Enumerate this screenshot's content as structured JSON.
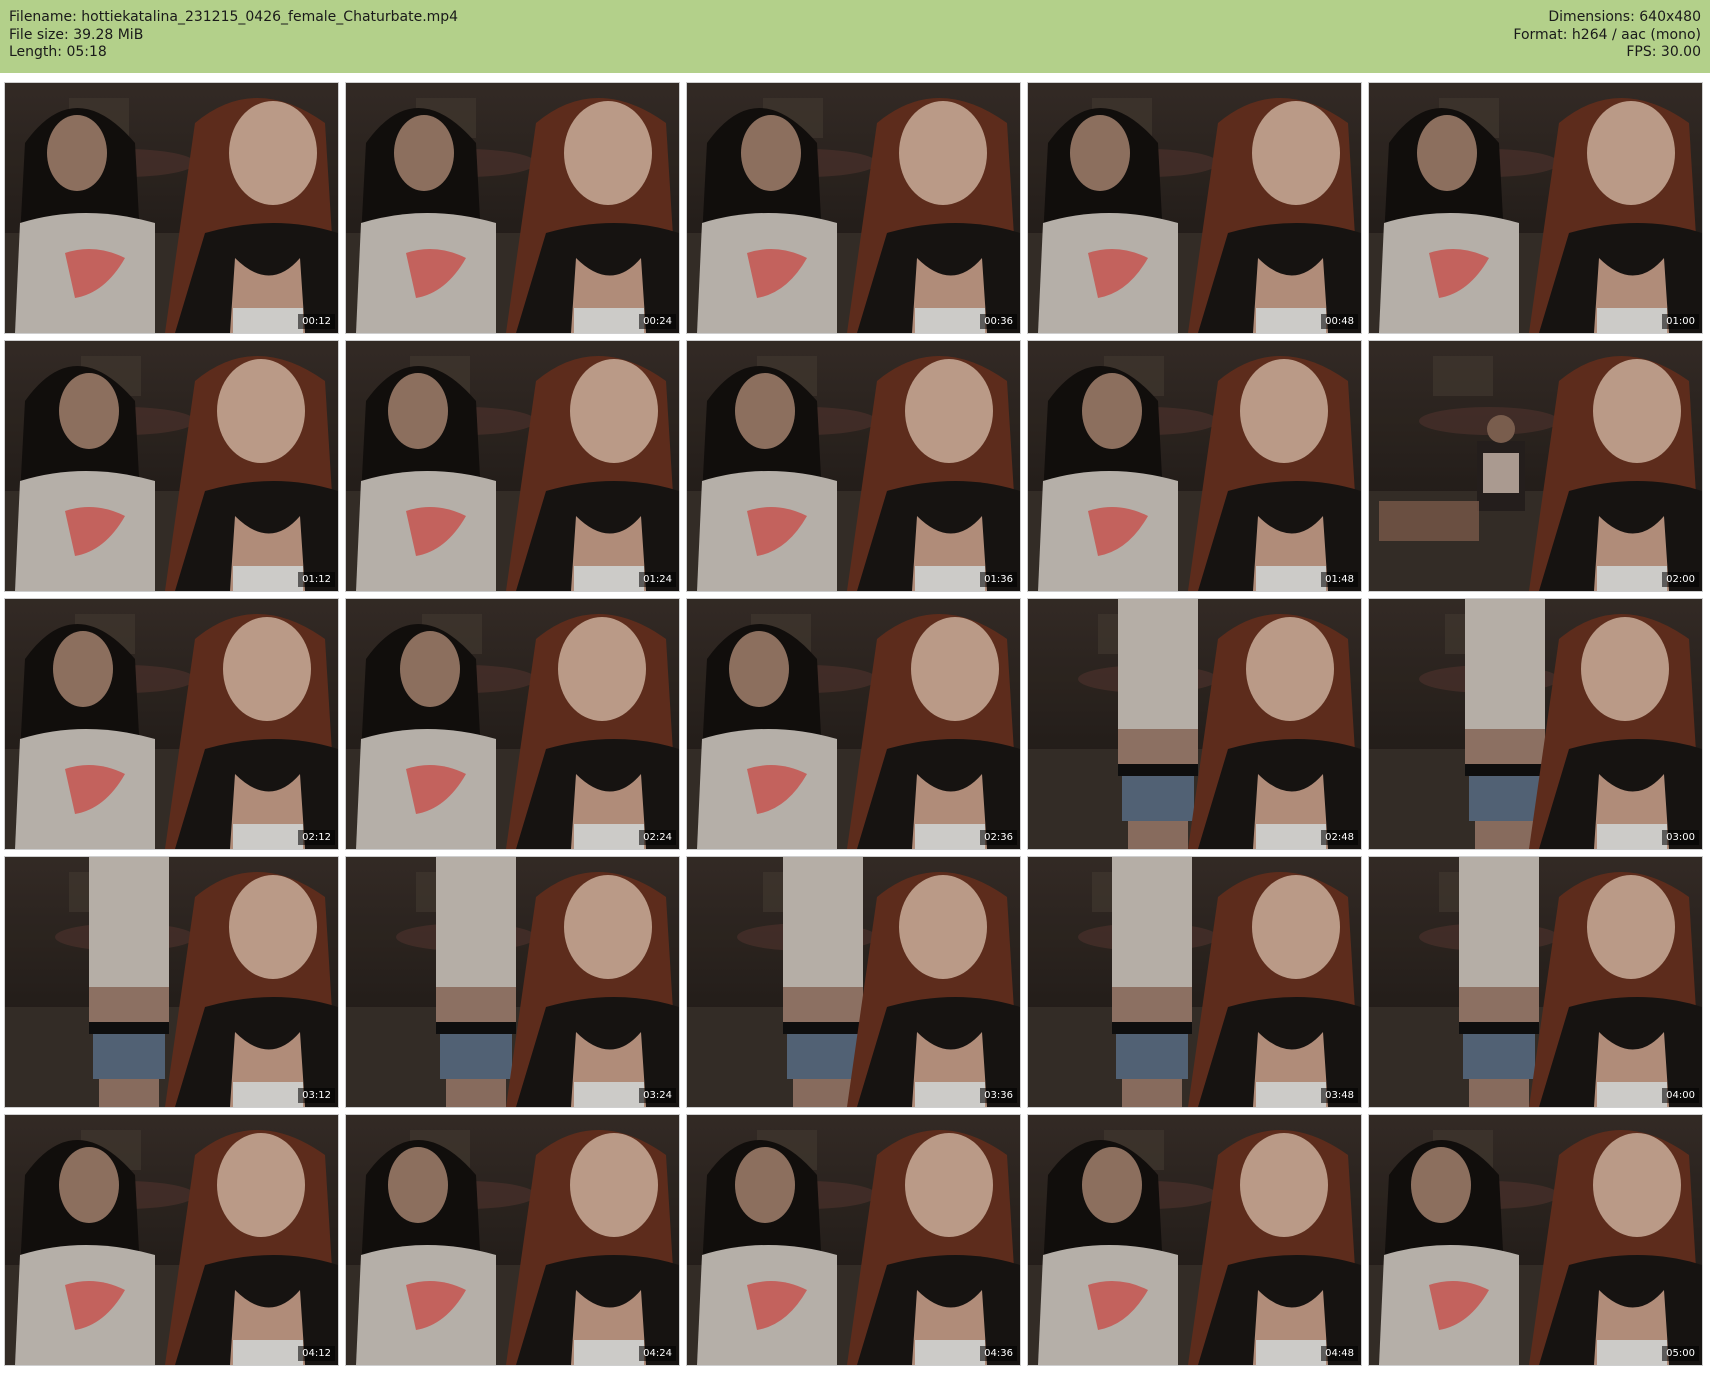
{
  "header": {
    "filename_line": "Filename: hottiekatalina_231215_0426_female_Chaturbate.mp4",
    "filesize_line": "File size: 39.28 MiB",
    "length_line": "Length: 05:18",
    "dimensions_line": "Dimensions: 640x480",
    "format_line": "Format: h264 / aac (mono)",
    "fps_line": "FPS: 30.00"
  },
  "colors": {
    "header_bg": "#b3d08a",
    "page_bg": "#ffffff"
  },
  "thumbnails": [
    {
      "timestamp": "00:12",
      "scene": "two-women-close"
    },
    {
      "timestamp": "00:24",
      "scene": "two-women-close"
    },
    {
      "timestamp": "00:36",
      "scene": "two-women-close"
    },
    {
      "timestamp": "00:48",
      "scene": "two-women-close"
    },
    {
      "timestamp": "01:00",
      "scene": "two-women-close"
    },
    {
      "timestamp": "01:12",
      "scene": "two-women-close"
    },
    {
      "timestamp": "01:24",
      "scene": "two-women-close"
    },
    {
      "timestamp": "01:36",
      "scene": "two-women-close"
    },
    {
      "timestamp": "01:48",
      "scene": "two-women-close"
    },
    {
      "timestamp": "02:00",
      "scene": "one-far-one-close"
    },
    {
      "timestamp": "02:12",
      "scene": "two-women-close"
    },
    {
      "timestamp": "02:24",
      "scene": "two-women-close"
    },
    {
      "timestamp": "02:36",
      "scene": "two-women-close"
    },
    {
      "timestamp": "02:48",
      "scene": "standing-and-close"
    },
    {
      "timestamp": "03:00",
      "scene": "standing-and-close"
    },
    {
      "timestamp": "03:12",
      "scene": "standing-and-close"
    },
    {
      "timestamp": "03:24",
      "scene": "standing-and-close"
    },
    {
      "timestamp": "03:36",
      "scene": "standing-and-close"
    },
    {
      "timestamp": "03:48",
      "scene": "standing-and-close"
    },
    {
      "timestamp": "04:00",
      "scene": "standing-and-close"
    },
    {
      "timestamp": "04:12",
      "scene": "two-women-close"
    },
    {
      "timestamp": "04:24",
      "scene": "two-women-close"
    },
    {
      "timestamp": "04:36",
      "scene": "two-women-close"
    },
    {
      "timestamp": "04:48",
      "scene": "two-women-close"
    },
    {
      "timestamp": "05:00",
      "scene": "two-women-close"
    }
  ]
}
